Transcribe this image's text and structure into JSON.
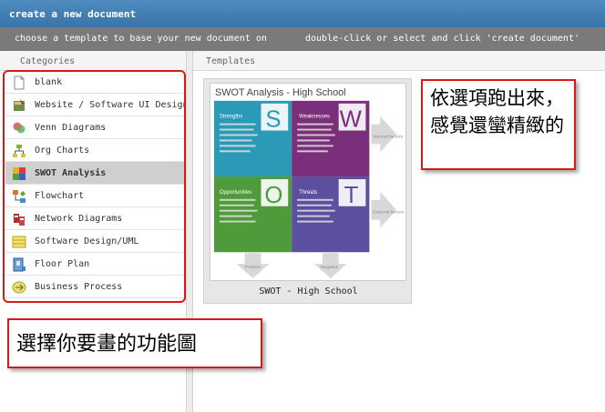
{
  "window": {
    "title": "create a new document"
  },
  "instructions": {
    "left": "choose a template to base your new document on",
    "right": "double-click or select and click 'create document'"
  },
  "columns": {
    "categories": "Categories",
    "templates": "Templates"
  },
  "categories": [
    {
      "label": "blank",
      "icon": "blank-page-icon"
    },
    {
      "label": "Website / Software UI Design",
      "icon": "website-ui-icon"
    },
    {
      "label": "Venn Diagrams",
      "icon": "venn-icon"
    },
    {
      "label": "Org Charts",
      "icon": "org-chart-icon"
    },
    {
      "label": "SWOT Analysis",
      "icon": "swot-icon",
      "selected": true
    },
    {
      "label": "Flowchart",
      "icon": "flowchart-icon"
    },
    {
      "label": "Network Diagrams",
      "icon": "network-icon"
    },
    {
      "label": "Software Design/UML",
      "icon": "uml-icon"
    },
    {
      "label": "Floor Plan",
      "icon": "floor-plan-icon"
    },
    {
      "label": "Business Process",
      "icon": "business-process-icon"
    }
  ],
  "template": {
    "caption": "SWOT - High School",
    "preview_title": "SWOT Analysis - High School",
    "quadrants": {
      "strengths": "Strengths",
      "weaknesses": "Weaknesses",
      "opportunities": "Opportunities",
      "threats": "Threats"
    },
    "letters": {
      "s": "S",
      "w": "W",
      "o": "O",
      "t": "T"
    },
    "side_labels": {
      "internal": "Internal factors",
      "external": "External factors"
    },
    "bottom_labels": {
      "positive": "Positive",
      "negative": "Negative"
    },
    "colors": {
      "strengths": "#2a9ab6",
      "weaknesses": "#7a2f7a",
      "opportunities": "#4f9a3a",
      "threats": "#5c4fa0"
    }
  },
  "annotations": {
    "left_note": "選擇你要畫的功能圖",
    "right_note": "依選項跑出來，感覺還蠻精緻的"
  }
}
